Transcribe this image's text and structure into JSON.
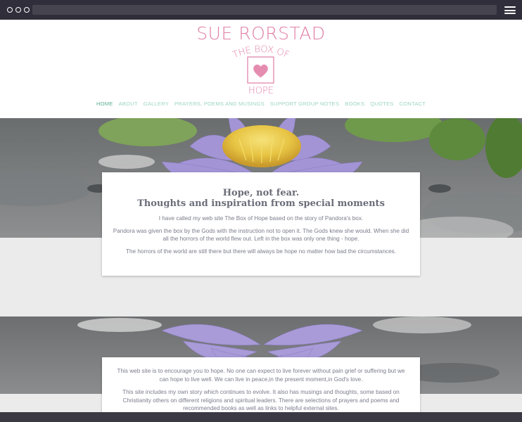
{
  "site": {
    "title": "SUE RORSTAD",
    "logo_top_text": "THE BOX OF",
    "logo_bottom_text": "HOPE"
  },
  "nav": {
    "items": [
      "HOME",
      "ABOUT",
      "GALLERY",
      "PRAYERS, POEMS AND MUSINGS",
      "SUPPORT GROUP NOTES",
      "BOOKS",
      "QUOTES",
      "CONTACT"
    ],
    "active": "HOME"
  },
  "intro": {
    "heading_line1": "Hope, not fear.",
    "heading_line2": "Thoughts and inspiration from special moments",
    "para1": "I have called my web site The Box of Hope based on the story of Pandora's box.",
    "para2": "Pandora was given the box by the Gods with the instruction not to open it. The Gods knew she would. When she did all the horrors of the world flew out. Left in the box was only one thing - hope.",
    "para3": "The horrors of the world are still there but there will always be hope no matter how bad the circumstances."
  },
  "about": {
    "para1": "This web site is to encourage you to hope. No one can expect to live forever without pain grief or suffering but we can hope to live well. We can live in peace,in the present moment,in God's love.",
    "para2": "This site includes my own story which continues to evolve. It also has musings and thoughts, some based on Christianity others on different religions and spiritual leaders. There are selections of prayers and poems and recommended books as well as links to helpful external sites."
  },
  "colors": {
    "brand_pink": "#e07da5",
    "nav_green": "#9dd4c4",
    "nav_active": "#5fae96",
    "chrome_dark": "#2f2e3a"
  },
  "icons": {
    "window_controls": "three-circles",
    "menu": "hamburger-icon",
    "logo": "heart-box-icon"
  }
}
